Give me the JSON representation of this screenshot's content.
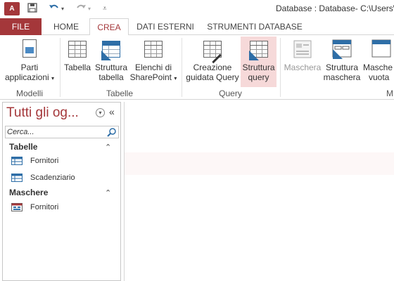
{
  "titlebar": {
    "app_icon_label": "A",
    "title": "Database : Database- C:\\Users\\O"
  },
  "tabs": [
    {
      "label": "FILE"
    },
    {
      "label": "HOME"
    },
    {
      "label": "CREA"
    },
    {
      "label": "DATI ESTERNI"
    },
    {
      "label": "STRUMENTI DATABASE"
    }
  ],
  "ribbon": {
    "buttons": {
      "parti": {
        "line1": "Parti",
        "line2": "applicazioni",
        "icon": "application-parts-icon"
      },
      "tabella": {
        "line1": "Tabella",
        "line2": "",
        "icon": "table-icon"
      },
      "struttura_tabella": {
        "line1": "Struttura",
        "line2": "tabella",
        "icon": "table-design-icon"
      },
      "elenchi": {
        "line1": "Elenchi di",
        "line2": "SharePoint",
        "icon": "sharepoint-lists-icon"
      },
      "creazione_query": {
        "line1": "Creazione",
        "line2": "guidata Query",
        "icon": "query-wizard-icon"
      },
      "struttura_query": {
        "line1": "Struttura",
        "line2": "query",
        "icon": "query-design-icon"
      },
      "maschera": {
        "line1": "Maschera",
        "line2": "",
        "icon": "form-icon"
      },
      "struttura_maschera": {
        "line1": "Struttura",
        "line2": "maschera",
        "icon": "form-design-icon"
      },
      "maschera_vuota": {
        "line1": "Masche",
        "line2": "vuota",
        "icon": "blank-form-icon"
      }
    },
    "groups": {
      "modelli": "Modelli",
      "tabelle": "Tabelle",
      "query": "Query",
      "maschere": "M"
    }
  },
  "nav": {
    "title": "Tutti gli og...",
    "search_placeholder": "Cerca...",
    "sections": [
      {
        "label": "Tabelle",
        "items": [
          "Fornitori",
          "Scadenziario"
        ]
      },
      {
        "label": "Maschere",
        "items": [
          "Fornitori"
        ]
      }
    ]
  },
  "colors": {
    "accent": "#a4373a",
    "highlight": "#f6d9d9"
  }
}
